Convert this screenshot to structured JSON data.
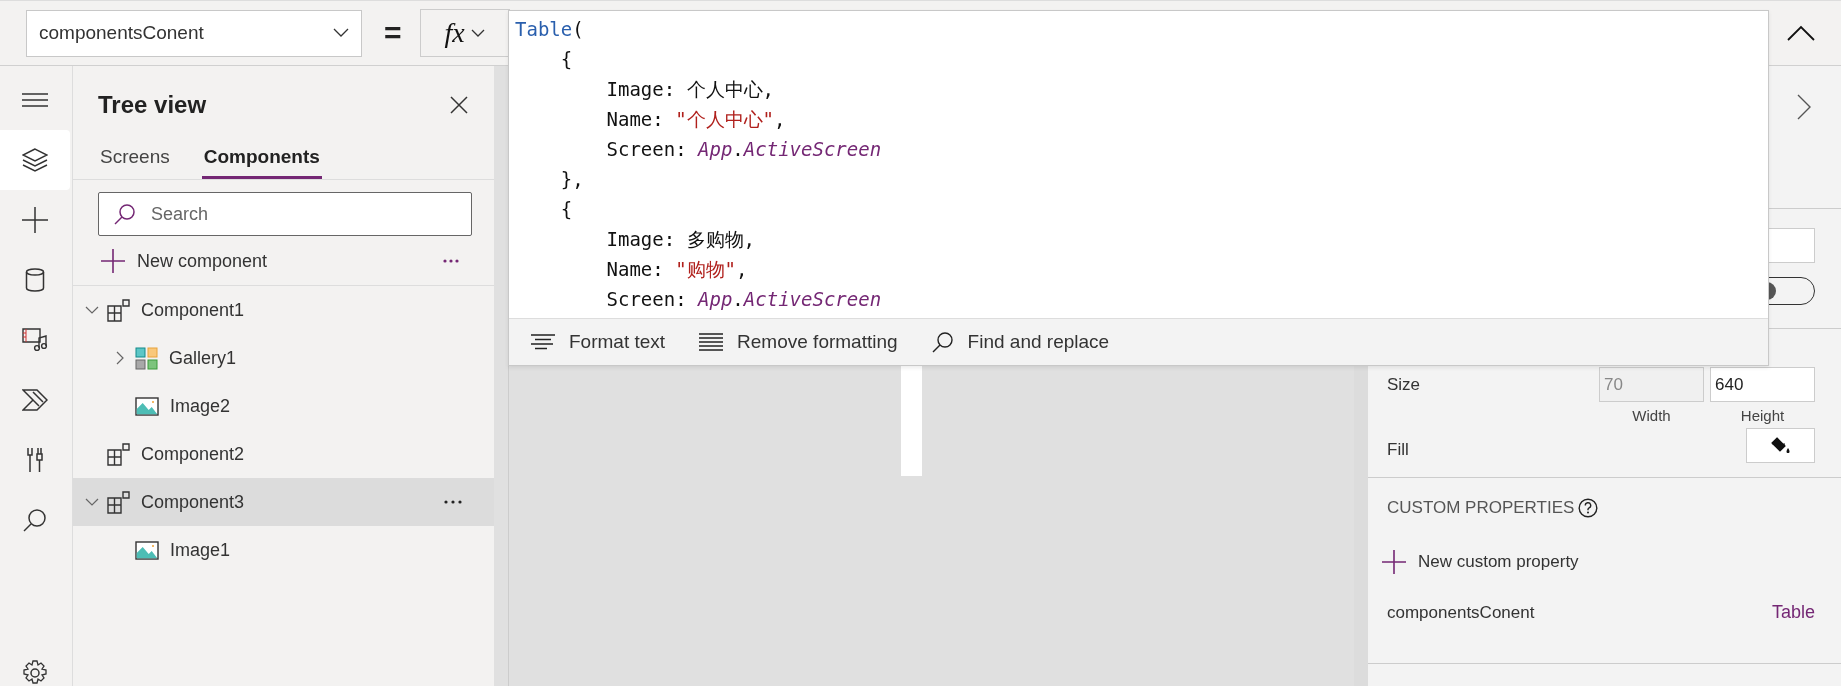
{
  "formula_bar": {
    "property": "componentsConent",
    "equals": "=",
    "fx": "fx"
  },
  "rail": [
    {
      "kind": "menu",
      "selected": false
    },
    {
      "kind": "layers",
      "selected": true
    },
    {
      "kind": "insert",
      "selected": false
    },
    {
      "kind": "data",
      "selected": false
    },
    {
      "kind": "media",
      "selected": false
    },
    {
      "kind": "automate",
      "selected": false
    },
    {
      "kind": "tools",
      "selected": false
    },
    {
      "kind": "search",
      "selected": false
    },
    {
      "kind": "settings",
      "selected": false
    }
  ],
  "tree_view": {
    "title": "Tree view",
    "tabs": [
      {
        "label": "Screens",
        "selected": false
      },
      {
        "label": "Components",
        "selected": true
      }
    ],
    "search": {
      "placeholder": "Search"
    },
    "new_component": "New component",
    "items": [
      {
        "label": "Component1",
        "kind": "component",
        "expanded": true,
        "selected": false,
        "children": [
          {
            "label": "Gallery1",
            "kind": "gallery",
            "expanded": false,
            "selected": false
          },
          {
            "label": "Image2",
            "kind": "image",
            "selected": false
          }
        ]
      },
      {
        "label": "Component2",
        "kind": "component",
        "selected": false
      },
      {
        "label": "Component3",
        "kind": "component",
        "expanded": true,
        "selected": true,
        "children": [
          {
            "label": "Image1",
            "kind": "image",
            "selected": false
          }
        ]
      }
    ]
  },
  "formula_editor": {
    "lines": [
      [
        {
          "kind": "function",
          "text": "Table"
        },
        {
          "kind": "plain",
          "text": "("
        }
      ],
      [
        {
          "kind": "plain",
          "text": "    {"
        }
      ],
      [
        {
          "kind": "plain",
          "text": "        Image: 个人中心,"
        }
      ],
      [
        {
          "kind": "plain",
          "text": "        Name: "
        },
        {
          "kind": "string",
          "text": "\"个人中心\""
        },
        {
          "kind": "plain",
          "text": ","
        }
      ],
      [
        {
          "kind": "plain",
          "text": "        Screen: "
        },
        {
          "kind": "reference",
          "text": "App"
        },
        {
          "kind": "plain",
          "text": "."
        },
        {
          "kind": "reference",
          "text": "ActiveScreen"
        }
      ],
      [
        {
          "kind": "plain",
          "text": "    },"
        }
      ],
      [
        {
          "kind": "plain",
          "text": "    {"
        }
      ],
      [
        {
          "kind": "plain",
          "text": "        Image: 多购物,"
        }
      ],
      [
        {
          "kind": "plain",
          "text": "        Name: "
        },
        {
          "kind": "string",
          "text": "\"购物\""
        },
        {
          "kind": "plain",
          "text": ","
        }
      ],
      [
        {
          "kind": "plain",
          "text": "        Screen: "
        },
        {
          "kind": "reference",
          "text": "App"
        },
        {
          "kind": "plain",
          "text": "."
        },
        {
          "kind": "reference",
          "text": "ActiveScreen"
        }
      ]
    ],
    "toolbar": [
      {
        "kind": "format",
        "label": "Format text"
      },
      {
        "kind": "remove",
        "label": "Remove formatting"
      },
      {
        "kind": "find",
        "label": "Find and replace"
      }
    ]
  },
  "properties": {
    "toggle": {
      "on": false
    },
    "size": {
      "label": "Size",
      "width": {
        "value": "70",
        "disabled": true
      },
      "height": {
        "value": "640",
        "disabled": false
      },
      "width_label": "Width",
      "height_label": "Height"
    },
    "fill_label": "Fill",
    "custom_properties": {
      "heading": "CUSTOM PROPERTIES",
      "new_button": "New custom property",
      "items": [
        {
          "name": "componentsConent",
          "type": "Table"
        }
      ]
    }
  }
}
